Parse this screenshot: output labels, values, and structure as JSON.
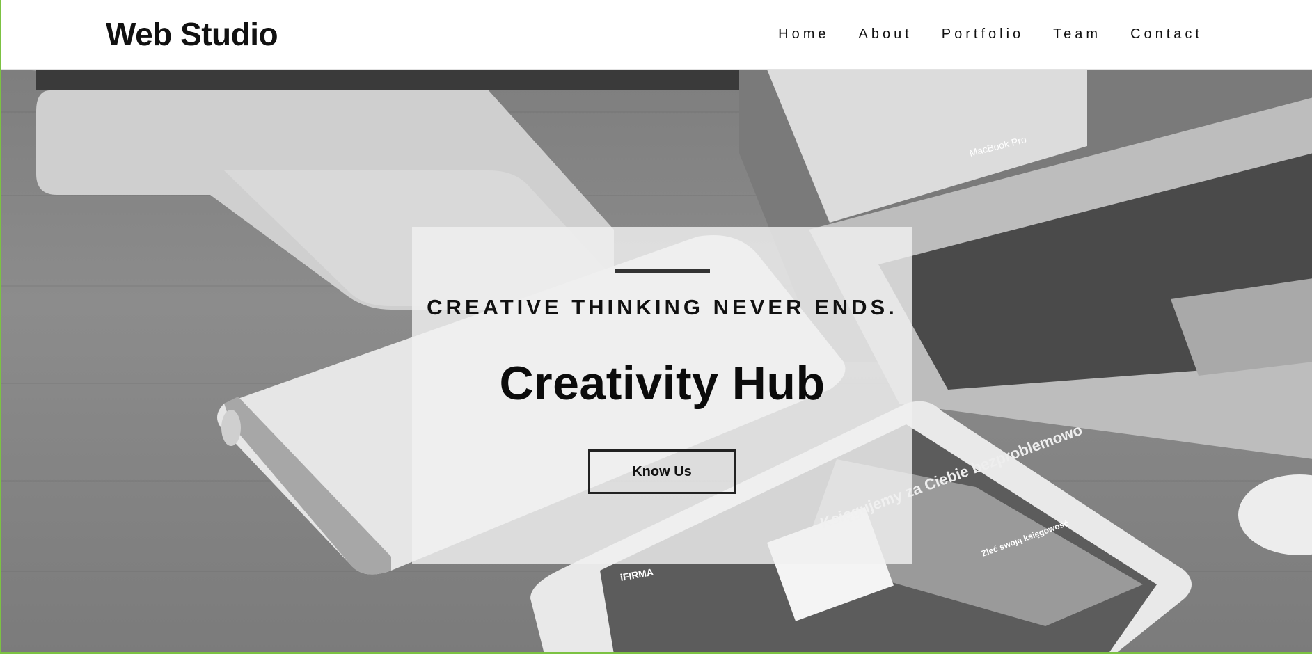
{
  "brand": {
    "logo_text": "Web Studio"
  },
  "nav": {
    "items": [
      {
        "label": "Home"
      },
      {
        "label": "About"
      },
      {
        "label": "Portfolio"
      },
      {
        "label": "Team"
      },
      {
        "label": "Contact"
      }
    ]
  },
  "hero": {
    "tagline": "CREATIVE THINKING NEVER ENDS.",
    "title": "Creativity Hub",
    "button_label": "Know Us"
  },
  "background_art": {
    "laptop_label": "MacBook Pro",
    "tablet_heading": "Księgujemy za Ciebie bezproblemowo",
    "tablet_brand": "iFIRMA",
    "tablet_button": "Zleć swoją księgowość"
  },
  "colors": {
    "accent_frame": "#7cc242",
    "card_background": "#f0f0f0",
    "text": "#111111"
  }
}
